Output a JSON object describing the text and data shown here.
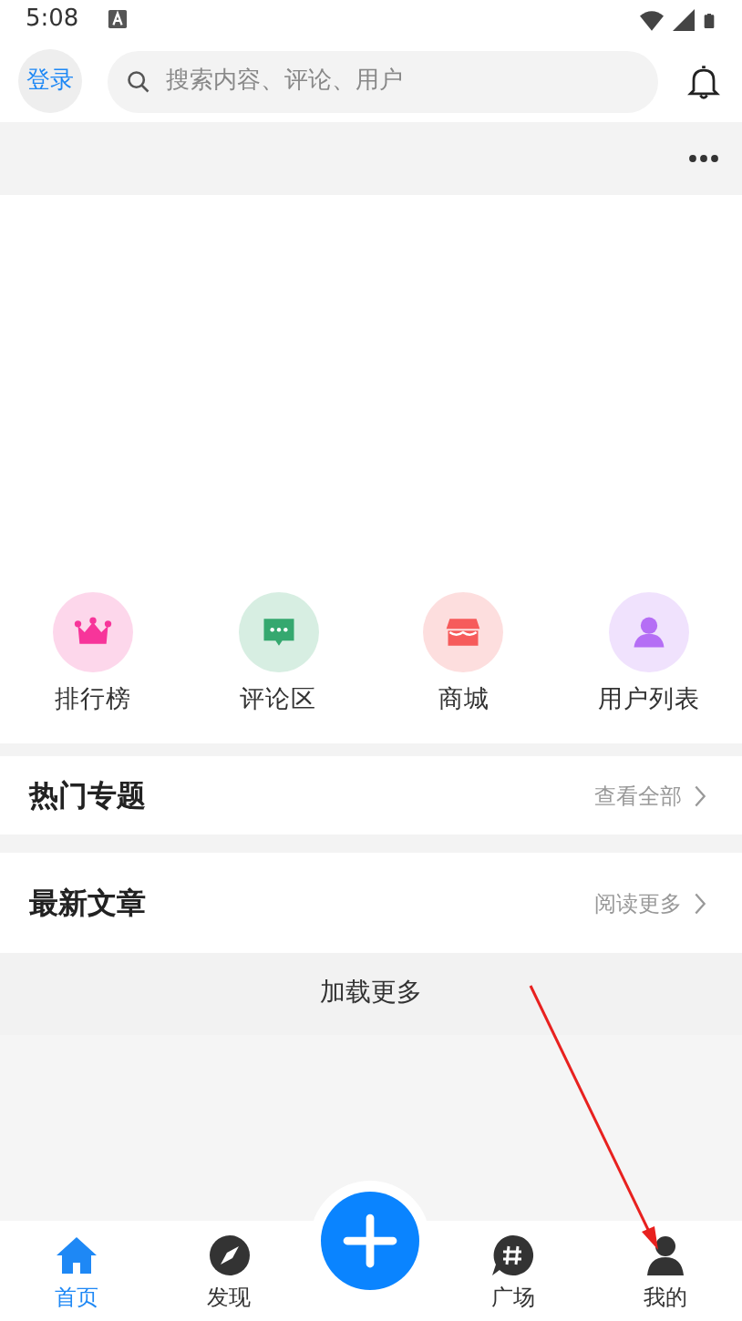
{
  "status_bar": {
    "time": "5:08"
  },
  "header": {
    "login": "登录",
    "search": {
      "placeholder": "搜索内容、评论、用户"
    }
  },
  "shortcuts": [
    {
      "kind": "crown",
      "label": "排行榜",
      "color": "#f7359a"
    },
    {
      "kind": "chat",
      "label": "评论区",
      "color": "#35a86f"
    },
    {
      "kind": "shop",
      "label": "商城",
      "color": "#f65b5b"
    },
    {
      "kind": "user",
      "label": "用户列表",
      "color": "#b56ef5"
    }
  ],
  "sections": [
    {
      "title": "热门专题",
      "link": "查看全部"
    },
    {
      "title": "最新文章",
      "link": "阅读更多"
    }
  ],
  "load_more": "加载更多",
  "tabs": [
    {
      "kind": "home",
      "label": "首页",
      "selected": true
    },
    {
      "kind": "compass",
      "label": "发现",
      "selected": false
    },
    {
      "kind": "add"
    },
    {
      "kind": "hash",
      "label": "广场",
      "selected": false
    },
    {
      "kind": "person",
      "label": "我的",
      "selected": false
    }
  ],
  "annotation_arrow": {
    "color": "#e8211f"
  }
}
